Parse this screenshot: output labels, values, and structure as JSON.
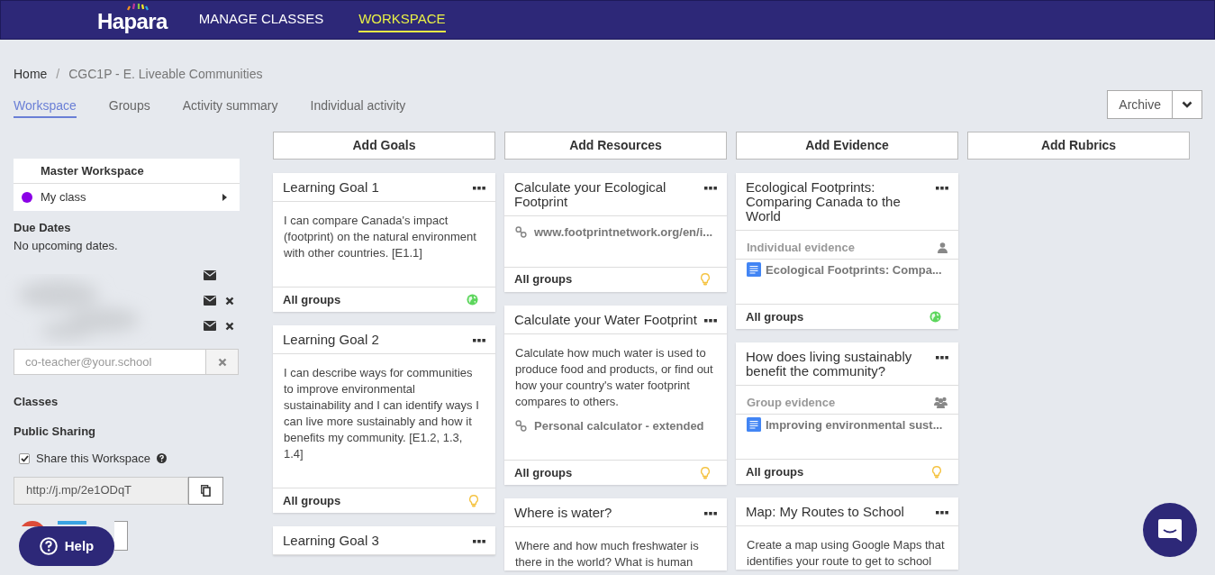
{
  "header": {
    "logo": "Hapara",
    "nav": [
      {
        "label": "MANAGE CLASSES",
        "selected": false
      },
      {
        "label": "WORKSPACE",
        "selected": true
      }
    ]
  },
  "breadcrumb": {
    "home": "Home",
    "separator": "/",
    "current": "CGC1P - E. Liveable Communities"
  },
  "tabs": [
    {
      "label": "Workspace",
      "selected": true
    },
    {
      "label": "Groups",
      "selected": false
    },
    {
      "label": "Activity summary",
      "selected": false
    },
    {
      "label": "Individual activity",
      "selected": false
    }
  ],
  "archive_button": "Archive",
  "sidebar": {
    "workspace_title": "Master Workspace",
    "class": {
      "label": "My class",
      "color": "#8a00e6"
    },
    "due_dates_title": "Due Dates",
    "due_dates_text": "No upcoming dates.",
    "coteachers": [
      {
        "removable": false
      },
      {
        "removable": true
      },
      {
        "removable": true
      }
    ],
    "coteacher_placeholder": "co-teacher@your.school",
    "classes_title": "Classes",
    "sharing_title": "Public Sharing",
    "share_checkbox": {
      "label": "Share this Workspace",
      "checked": true
    },
    "share_url": "http://j.mp/2e1ODqT"
  },
  "columns": [
    {
      "button": "Add Goals",
      "cards": [
        {
          "title": "Learning Goal 1",
          "items": [
            {
              "kind": "text",
              "text": "I can compare Canada's impact (footprint) on the natural environment with other countries. [E1.1]"
            }
          ],
          "footer": "All groups",
          "published": true
        },
        {
          "title": "Learning Goal 2",
          "items": [
            {
              "kind": "text",
              "text": "I can describe ways for communities to improve environmental sustainability and I can identify ways I can live more sustainably and how it benefits my community. [E1.2, 1.3, 1.4]"
            }
          ],
          "footer": "All groups",
          "published": false
        },
        {
          "title": "Learning Goal 3"
        }
      ]
    },
    {
      "button": "Add Resources",
      "cards": [
        {
          "title": "Calculate your Ecological Footprint",
          "items": [
            {
              "kind": "link",
              "text": "www.footprintnetwork.org/en/i..."
            }
          ],
          "footer": "All groups",
          "published": false
        },
        {
          "title": "Calculate your Water Footprint",
          "items": [
            {
              "kind": "text",
              "text": "Calculate how much water is used to produce food and products, or find out how your country's water footprint compares to others."
            },
            {
              "kind": "link",
              "text": "Personal calculator - extended"
            }
          ],
          "footer": "All groups",
          "published": false
        },
        {
          "title": "Where is water?",
          "items": [
            {
              "kind": "text",
              "text": "Where and how much freshwater is there in the world? What is human"
            }
          ]
        }
      ]
    },
    {
      "button": "Add Evidence",
      "cards": [
        {
          "title": "Ecological Footprints: Comparing Canada to the World",
          "items": [
            {
              "kind": "individual_evidence",
              "text": "Individual evidence"
            },
            {
              "kind": "doc",
              "text": "Ecological Footprints: Compa..."
            }
          ],
          "footer": "All groups",
          "published": true
        },
        {
          "title": "How does living sustainably benefit the community?",
          "items": [
            {
              "kind": "group_evidence",
              "text": "Group evidence"
            },
            {
              "kind": "doc",
              "text": "Improving environmental sust..."
            }
          ],
          "footer": "All groups",
          "published": false
        },
        {
          "title": "Map: My Routes to School",
          "items": [
            {
              "kind": "text",
              "text": "Create a map using Google Maps that identifies your route to get to school"
            }
          ]
        }
      ]
    },
    {
      "button": "Add Rubrics"
    }
  ],
  "help_button": "Help"
}
